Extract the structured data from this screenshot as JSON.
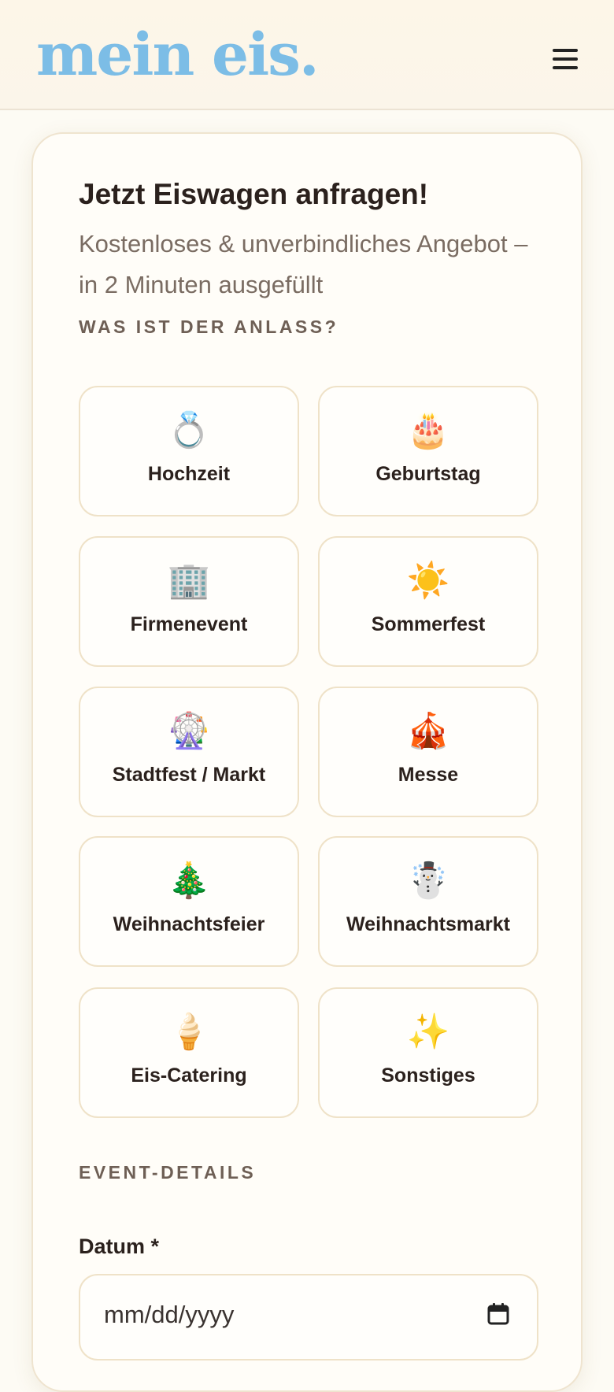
{
  "header": {
    "logo": "mein eis.",
    "menu_icon": "hamburger-menu-icon"
  },
  "form": {
    "title": "Jetzt Eiswagen anfragen!",
    "subtitle": "Kostenloses & unverbindliches Angebot – in 2 Minuten ausgefüllt",
    "occasion_label": "WAS IST DER ANLASS?",
    "occasions": [
      {
        "icon": "💍",
        "label": "Hochzeit"
      },
      {
        "icon": "🎂",
        "label": "Geburtstag"
      },
      {
        "icon": "🏢",
        "label": "Firmenevent"
      },
      {
        "icon": "☀️",
        "label": "Sommerfest"
      },
      {
        "icon": "🎡",
        "label": "Stadtfest / Markt"
      },
      {
        "icon": "🎪",
        "label": "Messe"
      },
      {
        "icon": "🎄",
        "label": "Weihnachtsfeier"
      },
      {
        "icon": "☃️",
        "label": "Weihnachtsmarkt"
      },
      {
        "icon": "🍦",
        "label": "Eis-Catering"
      },
      {
        "icon": "✨",
        "label": "Sonstiges"
      }
    ],
    "details_label": "EVENT-DETAILS",
    "date_label": "Datum *",
    "date_placeholder": "mm/dd/yyyy",
    "calendar_icon": "calendar-icon"
  },
  "colors": {
    "logo": "#7cbde6",
    "background": "#fdfbf4",
    "card_border": "#efe4cf",
    "text": "#2b211d",
    "muted_text": "#7a6c62"
  }
}
